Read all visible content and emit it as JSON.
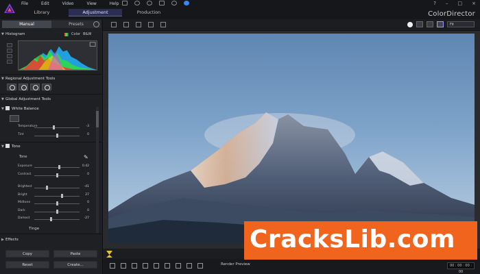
{
  "menu": [
    "File",
    "Edit",
    "Video",
    "View",
    "Help"
  ],
  "modes": [
    {
      "label": "Library",
      "active": false
    },
    {
      "label": "Adjustment",
      "active": true
    },
    {
      "label": "Production",
      "active": false
    }
  ],
  "brand": "ColorDirector",
  "window_controls": [
    "?",
    "–",
    "□",
    "×"
  ],
  "left_panel": {
    "tabs": [
      {
        "label": "Manual",
        "active": true
      },
      {
        "label": "Presets",
        "active": false
      }
    ],
    "histogram": {
      "title": "Histogram",
      "color_label": "Color",
      "bw_label": "B&W"
    },
    "regional": {
      "title": "Regional Adjustment Tools"
    },
    "global": {
      "title": "Global Adjustment Tools"
    },
    "white_balance": {
      "title": "White Balance",
      "sliders": [
        {
          "label": "Temperature",
          "value": "-3",
          "pos": 0.43
        },
        {
          "label": "Tint",
          "value": "0",
          "pos": 0.5
        }
      ]
    },
    "tone": {
      "title": "Tone",
      "subtitle": "Tone",
      "sliders1": [
        {
          "label": "Exposure",
          "value": "0.42",
          "pos": 0.55
        },
        {
          "label": "Contrast",
          "value": "0",
          "pos": 0.5
        }
      ],
      "sliders2": [
        {
          "label": "Brightest",
          "value": "-41",
          "pos": 0.28
        },
        {
          "label": "Bright",
          "value": "27",
          "pos": 0.62
        },
        {
          "label": "Midtone",
          "value": "0",
          "pos": 0.5
        },
        {
          "label": "Dark",
          "value": "0",
          "pos": 0.5
        },
        {
          "label": "Darkest",
          "value": "-27",
          "pos": 0.37
        }
      ],
      "tinge_label": "Tinge"
    },
    "effects": {
      "title": "Effects"
    },
    "buttons": {
      "copy": "Copy",
      "paste": "Paste",
      "reset": "Reset",
      "create": "Create..."
    }
  },
  "viewer": {
    "fit_value": "Fit",
    "render_preview": "Render Preview",
    "timecode": "00 : 00 : 00 : 00"
  },
  "watermark": "CracksLib.com",
  "colors": {
    "accent": "#5a5fc8",
    "watermark_bg": "#f0641d",
    "timeline_handle": "#e8c32a"
  }
}
